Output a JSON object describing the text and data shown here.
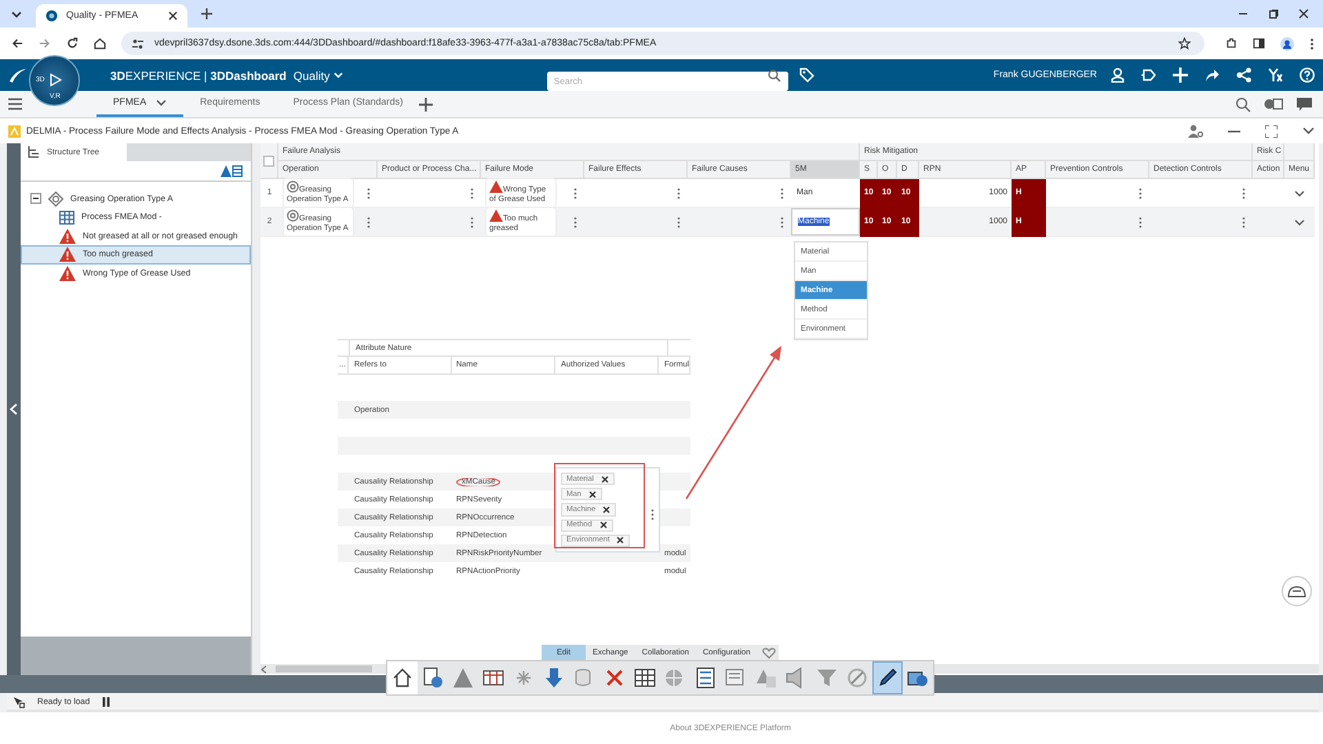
{
  "browser": {
    "tab_title": "Quality - PFMEA",
    "url": "vdevpril3637dsy.dsone.3ds.com:444/3DDashboard/#dashboard:f18afe33-3963-477f-a3a1-a7838ac75c8a/tab:PFMEA"
  },
  "top_bar": {
    "compass_labels": [
      "3D",
      "V,R"
    ],
    "brand": "**3D**EXPERIENCE | **3DDashboard**",
    "app": "Quality",
    "search_placeholder": "Search",
    "user": "Frank GUGENBERGER"
  },
  "dashboard_tabs": [
    {
      "label": "PFMEA",
      "selected": true
    },
    {
      "label": "Requirements",
      "selected": false
    },
    {
      "label": "Process Plan (Standards)",
      "selected": false
    }
  ],
  "app_title": "DELMIA - Process Failure Mode and Effects Analysis - Process FMEA Mod - Greasing Operation Type A",
  "structure_tree": {
    "tab": "Structure Tree",
    "items": [
      {
        "label": "Greasing Operation Type A",
        "kind": "operation",
        "expanded": true,
        "selected": false,
        "children": [
          {
            "label": "Process FMEA Mod -",
            "kind": "table",
            "selected": false
          },
          {
            "label": "Not greased at all or not greased enough",
            "kind": "failure",
            "selected": false
          },
          {
            "label": "Too much greased",
            "kind": "failure",
            "selected": true
          },
          {
            "label": "Wrong Type of Grease Used",
            "kind": "failure",
            "selected": false
          }
        ]
      }
    ]
  },
  "grid": {
    "select_all_checked": false,
    "groups": [
      {
        "label": "Failure Analysis"
      },
      {
        "label": "Risk Mitigation"
      },
      {
        "label": "Risk C"
      }
    ],
    "columns": [
      {
        "label": "Operation",
        "highlighted": false
      },
      {
        "label": "Product or Process Cha...",
        "highlighted": false
      },
      {
        "label": "Failure Mode",
        "highlighted": false
      },
      {
        "label": "Failure Effects",
        "highlighted": false
      },
      {
        "label": "Failure Causes",
        "highlighted": false
      },
      {
        "label": "5M",
        "highlighted": true
      },
      {
        "label": "S",
        "highlighted": false
      },
      {
        "label": "O",
        "highlighted": false
      },
      {
        "label": "D",
        "highlighted": false
      },
      {
        "label": "RPN",
        "highlighted": false
      },
      {
        "label": "AP",
        "highlighted": false
      },
      {
        "label": "Prevention Controls",
        "highlighted": false
      },
      {
        "label": "Detection Controls",
        "highlighted": false
      },
      {
        "label": "Action",
        "highlighted": false
      },
      {
        "label": "Menu",
        "highlighted": false
      }
    ],
    "rows": [
      {
        "index": "1",
        "operation": "Greasing Operation Type A",
        "failure_mode": "Wrong Type of Grease Used",
        "five_m": "Man",
        "severity": "10",
        "occurrence": "10",
        "detection": "10",
        "rpn": "1000",
        "ap": "H",
        "selected": false,
        "editing": false
      },
      {
        "index": "2",
        "operation": "Greasing Operation Type A",
        "failure_mode": "Too much greased",
        "five_m": "Machine",
        "severity": "10",
        "occurrence": "10",
        "detection": "10",
        "rpn": "1000",
        "ap": "H",
        "selected": true,
        "editing": true
      }
    ],
    "dropdown": [
      {
        "label": "Material",
        "selected": false
      },
      {
        "label": "Man",
        "selected": false
      },
      {
        "label": "Machine",
        "selected": true
      },
      {
        "label": "Method",
        "selected": false
      },
      {
        "label": "Environment",
        "selected": false
      }
    ]
  },
  "attribute_screenshot": {
    "group": "Attribute Nature",
    "columns": [
      "...",
      "Refers to",
      "Name",
      "Authorized Values",
      "Formul"
    ],
    "rows": [
      {
        "kind": "blank"
      },
      {
        "kind": "row",
        "refers_to": "Operation"
      },
      {
        "kind": "blank"
      },
      {
        "kind": "blank"
      },
      {
        "kind": "blank"
      },
      {
        "kind": "row",
        "refers_to": "Causality Relationship",
        "name": "xMCause",
        "circled": true
      },
      {
        "kind": "row",
        "refers_to": "Causality Relationship",
        "name": "RPNSeverity",
        "circled": false
      },
      {
        "kind": "row",
        "refers_to": "Causality Relationship",
        "name": "RPNOccurrence",
        "circled": false
      },
      {
        "kind": "row",
        "refers_to": "Causality Relationship",
        "name": "RPNDetection",
        "circled": false
      },
      {
        "kind": "row",
        "refers_to": "Causality Relationship",
        "name": "RPNRiskPriorityNumber",
        "formula": "modul",
        "circled": false
      },
      {
        "kind": "row",
        "refers_to": "Causality Relationship",
        "name": "RPNActionPriority",
        "formula": "modul",
        "circled": false
      }
    ],
    "authorized_values": [
      "Material",
      "Man",
      "Machine",
      "Method",
      "Environment"
    ]
  },
  "command_tabs": [
    {
      "label": "Edit",
      "selected": true
    },
    {
      "label": "Exchange",
      "selected": false
    },
    {
      "label": "Collaboration",
      "selected": false
    },
    {
      "label": "Configuration",
      "selected": false
    }
  ],
  "status_bar": {
    "text": "Ready to load"
  },
  "footer": "About 3DEXPERIENCE Platform"
}
